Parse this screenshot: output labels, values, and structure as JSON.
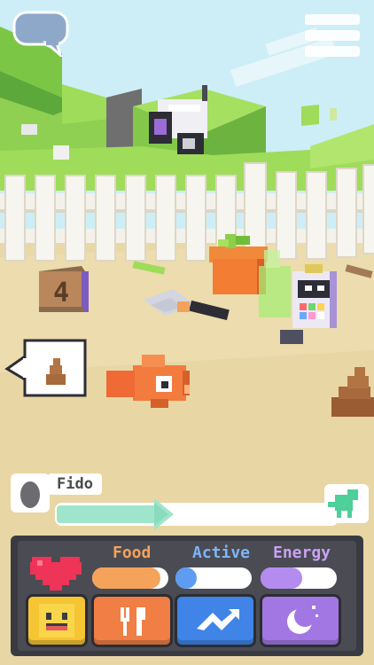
{
  "top_bar": {
    "chat_icon": "speech-bubble-icon",
    "menu_icon": "hamburger-menu-icon"
  },
  "scene": {
    "thought_bubble_icon": "poop-icon",
    "block_glyph": "4"
  },
  "pet": {
    "name": "Fido",
    "stage_icon": "egg-icon",
    "next_stage_icon": "dino-silhouette-icon",
    "evolution_progress": 0.36
  },
  "stats": {
    "health_icon": "heart-icon",
    "food": {
      "label": "Food",
      "level": 0.9,
      "color": "#f5a35a"
    },
    "active": {
      "label": "Active",
      "level": 0.2,
      "color": "#5e9cf2"
    },
    "energy": {
      "label": "Energy",
      "level": 0.55,
      "color": "#b48cf0"
    }
  },
  "actions": [
    {
      "id": "mood",
      "icon": "smiley-face-icon",
      "color": "#f6c533"
    },
    {
      "id": "feed",
      "icon": "fork-knife-icon",
      "color": "#f07e45"
    },
    {
      "id": "play",
      "icon": "jump-arrow-icon",
      "color": "#3f84e6"
    },
    {
      "id": "sleep",
      "icon": "moon-stars-icon",
      "color": "#a277e3"
    }
  ],
  "colors": {
    "sky": "#cdeef7",
    "grass": "#9fdc5a",
    "sand": "#ecdcae",
    "fence": "#f4f1ea",
    "panel": "#3a3b42"
  }
}
